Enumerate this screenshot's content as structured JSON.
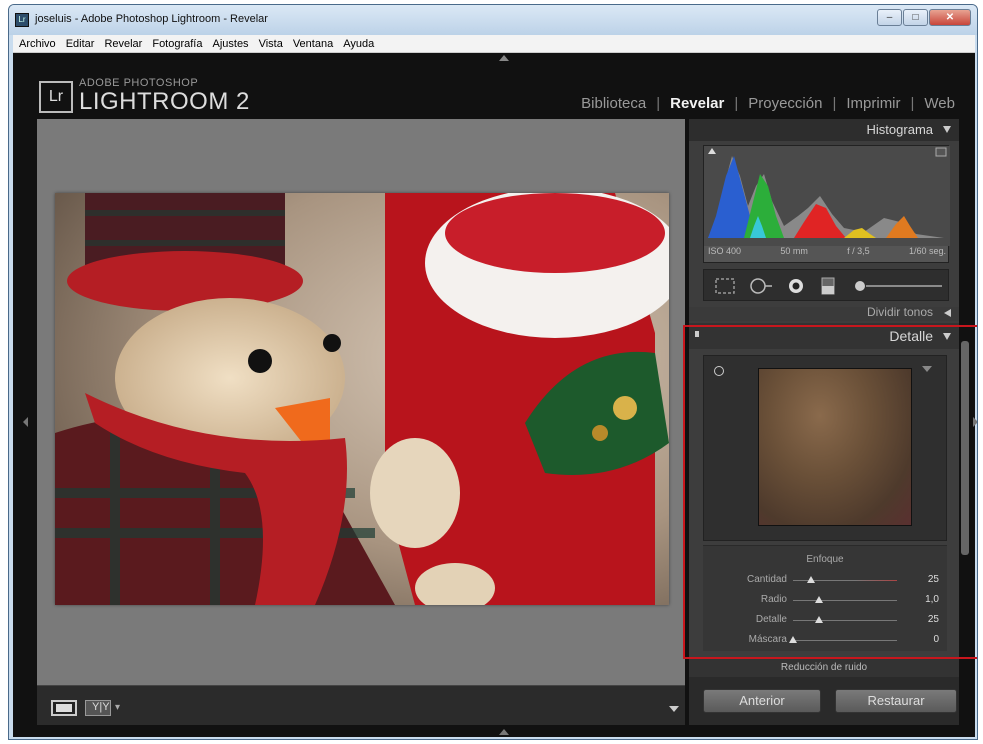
{
  "window": {
    "title": "joseluis - Adobe Photoshop Lightroom - Revelar",
    "app_icon": "Lr"
  },
  "menubar": {
    "items": [
      "Archivo",
      "Editar",
      "Revelar",
      "Fotografía",
      "Ajustes",
      "Vista",
      "Ventana",
      "Ayuda"
    ]
  },
  "brand": {
    "badge": "Lr",
    "small": "ADOBE PHOTOSHOP",
    "big": "LIGHTROOM 2"
  },
  "modules": {
    "items": [
      "Biblioteca",
      "Revelar",
      "Proyección",
      "Imprimir",
      "Web"
    ],
    "active": "Revelar",
    "separator": "|"
  },
  "histogram": {
    "title": "Histograma",
    "iso": "ISO 400",
    "focal": "50 mm",
    "aperture": "f / 3,5",
    "shutter": "1/60 seg."
  },
  "panels": {
    "dividir_tonos": "Dividir tonos",
    "detalle": "Detalle",
    "ruido": "Reducción de ruido"
  },
  "enfoque": {
    "title": "Enfoque",
    "sliders": [
      {
        "label": "Cantidad",
        "value": "25",
        "fraction": 0.17
      },
      {
        "label": "Radio",
        "value": "1,0",
        "fraction": 0.25
      },
      {
        "label": "Detalle",
        "value": "25",
        "fraction": 0.25
      },
      {
        "label": "Máscara",
        "value": "0",
        "fraction": 0.0
      }
    ]
  },
  "buttons": {
    "anterior": "Anterior",
    "restaurar": "Restaurar"
  },
  "colors": {
    "highlight": "#c8161d",
    "active_module": "#f2f2f2"
  }
}
